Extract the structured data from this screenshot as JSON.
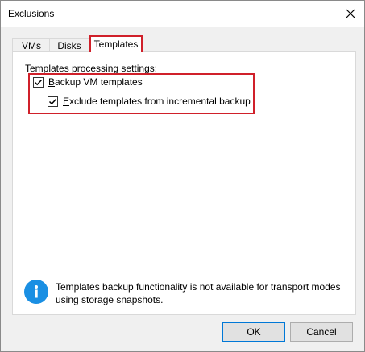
{
  "window": {
    "title": "Exclusions"
  },
  "tabs": [
    {
      "label": "VMs",
      "active": false
    },
    {
      "label": "Disks",
      "active": false
    },
    {
      "label": "Templates",
      "active": true
    }
  ],
  "settings": {
    "group_label": "Templates processing settings:",
    "backup_vm_templates": {
      "label": "Backup VM templates",
      "mnemonic": "B",
      "rest": "ackup VM templates",
      "checked": true
    },
    "exclude_incremental": {
      "label": "Exclude templates from incremental backup",
      "mnemonic": "E",
      "rest": "xclude templates from incremental backup",
      "checked": true
    }
  },
  "info": {
    "icon": "info-icon",
    "text": "Templates backup functionality is not available for transport modes using storage snapshots."
  },
  "buttons": {
    "ok": "OK",
    "cancel": "Cancel"
  },
  "colors": {
    "highlight": "#d0202a",
    "info_blue": "#1a8fe3",
    "ok_border": "#0078d7"
  }
}
